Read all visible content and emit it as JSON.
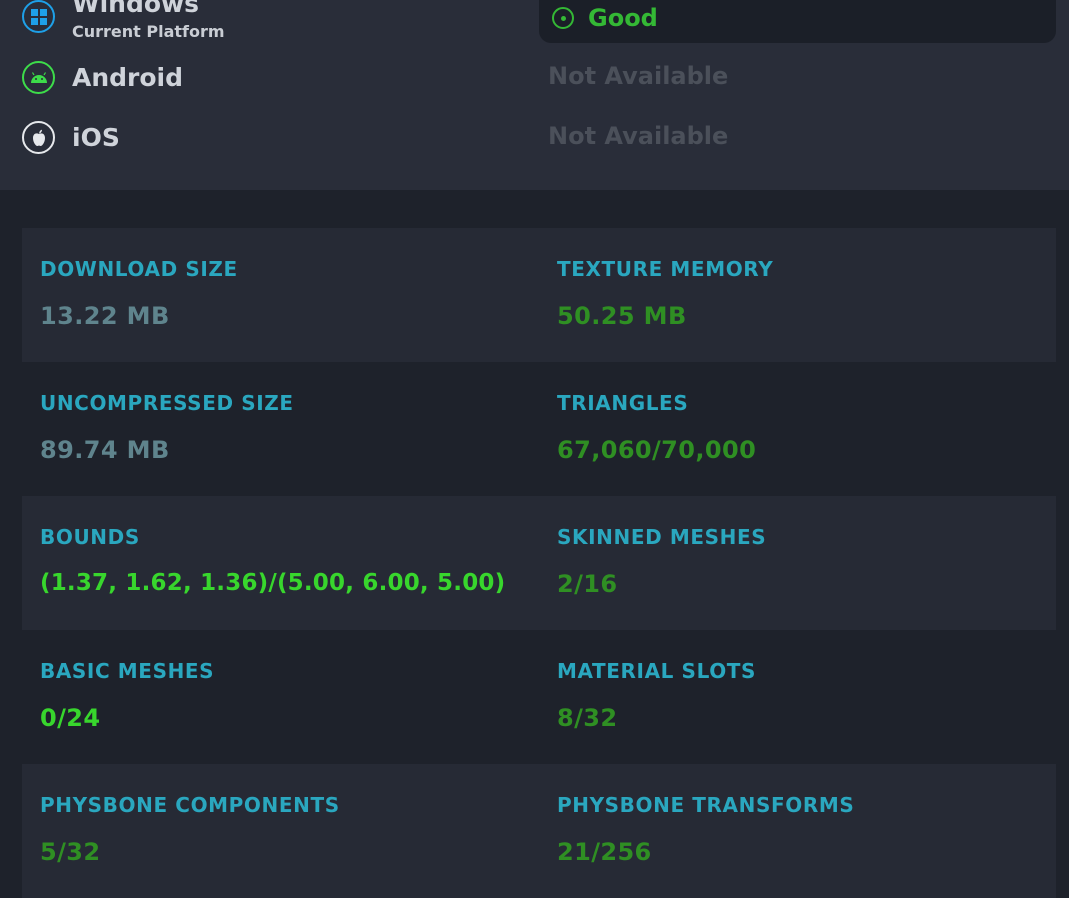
{
  "platforms": [
    {
      "name": "Windows",
      "subtitle": "Current Platform",
      "icon": "windows-icon"
    },
    {
      "name": "Android",
      "status": "Not Available",
      "icon": "android-icon"
    },
    {
      "name": "iOS",
      "status": "Not Available",
      "icon": "apple-icon"
    }
  ],
  "current_status": {
    "label": "Good",
    "icon": "status-good-icon"
  },
  "stats": {
    "download_size": {
      "title": "DOWNLOAD SIZE",
      "value": "13.22 MB"
    },
    "texture_memory": {
      "title": "TEXTURE MEMORY",
      "value": "50.25 MB"
    },
    "uncompressed_size": {
      "title": "UNCOMPRESSED SIZE",
      "value": "89.74 MB"
    },
    "triangles": {
      "title": "TRIANGLES",
      "value": "67,060/70,000"
    },
    "bounds": {
      "title": "BOUNDS",
      "value": "(1.37, 1.62, 1.36)/(5.00, 6.00, 5.00)"
    },
    "skinned_meshes": {
      "title": "SKINNED MESHES",
      "value": "2/16"
    },
    "basic_meshes": {
      "title": "BASIC MESHES",
      "value": "0/24"
    },
    "material_slots": {
      "title": "MATERIAL SLOTS",
      "value": "8/32"
    },
    "physbone_components": {
      "title": "PHYSBONE COMPONENTS",
      "value": "5/32"
    },
    "physbone_transforms": {
      "title": "PHYSBONE TRANSFORMS",
      "value": "21/256"
    }
  },
  "colors": {
    "accent_title": "#2aa7bf",
    "good": "#34b835",
    "value_green": "#2f8f23",
    "value_bright": "#38d62d",
    "value_gray": "#5f848d",
    "windows": "#1ea0e8",
    "android": "#3ddc4a"
  }
}
